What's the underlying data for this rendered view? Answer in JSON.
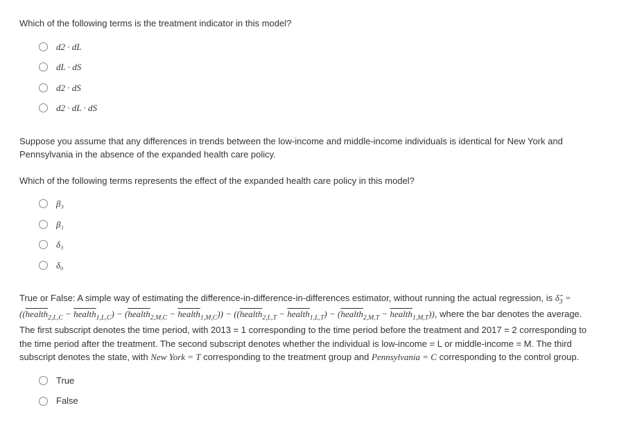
{
  "q1": {
    "prompt": "Which of the following terms is the treatment indicator in this model?",
    "options": [
      "d2 · dL",
      "dL · dS",
      "d2 · dS",
      "d2 · dL · dS"
    ]
  },
  "q2": {
    "assumption": "Suppose you assume that any differences in trends between the low-income and middle-income individuals is identical for New York and Pennsylvania in the absence of the expanded health care policy.",
    "prompt": "Which of the following terms represents the effect of the expanded health care policy in this model?",
    "options": [
      "β₃",
      "β₁",
      "δ₃",
      "δ₀"
    ]
  },
  "q3": {
    "tf_label": "True or False:",
    "lead": " A simple way of estimating the difference-in-difference-in-differences estimator, without running the actual regression, is ",
    "formula_plain": "δ̂₃ = ((health̄₂,L,C − health̄₁,L,C) − (health̄₂,M,C − health̄₁,M,C)) − ((health̄₂,L,T − health̄₁,L,T) − (health̄₂,M,T − health̄₁,M,T))",
    "post_formula_lead": ", where the bar denotes the average. The first subscript denotes the time period, with 2013 = 1 corresponding to the time period before the treatment and 2017 = 2 corresponding to the time period after the treatment. The second subscript denotes whether the individual is low-income = L or middle-income = M. The third subscript denotes the state, with ",
    "ny": "New York = T",
    "mid": " corresponding to the treatment group and ",
    "pa": "Pennsylvania = C",
    "tail": " corresponding to the control group.",
    "options": [
      "True",
      "False"
    ]
  }
}
